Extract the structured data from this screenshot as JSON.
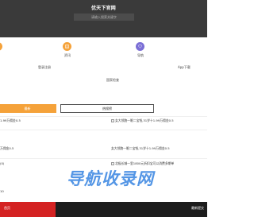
{
  "header": {
    "site_title": "优天下官网",
    "search_placeholder": "请输入搜索关键字"
  },
  "nav": {
    "items": [
      {
        "label": "资讯",
        "icon": "document-icon",
        "color": "#f5a23a"
      },
      {
        "label": "导航",
        "icon": "heart-icon",
        "color": "#7b6fd6"
      },
      {
        "label": "登录注册"
      },
      {
        "label": "App下载"
      },
      {
        "label": "国家检查"
      }
    ]
  },
  "tabs": {
    "active": "最新",
    "inactive": "热搜榜"
  },
  "list": {
    "rows": [
      {
        "left": "1.99万佣金0.5",
        "right": "女大领跑一眼二宝钱,31岁十1.99万佣金0.5"
      },
      {
        "left": "万佣金0.5",
        "right": "女大领跑一眼二宝钱,31岁十1.99万佣金0.5"
      },
      {
        "left": "(0)",
        "right": "北极长城一里1800元折扣宝可以消费多期单"
      },
      {
        "left": "10",
        "right": ""
      }
    ]
  },
  "watermark": "导航收录网",
  "footer": {
    "left_text": "首页",
    "right_text": "最新提交"
  },
  "colors": {
    "header_bg": "#3a3a3a",
    "accent_orange": "#f5a23a",
    "accent_purple": "#7b6fd6",
    "footer_red": "#d42222",
    "watermark_blue": "#2f7fe0"
  }
}
